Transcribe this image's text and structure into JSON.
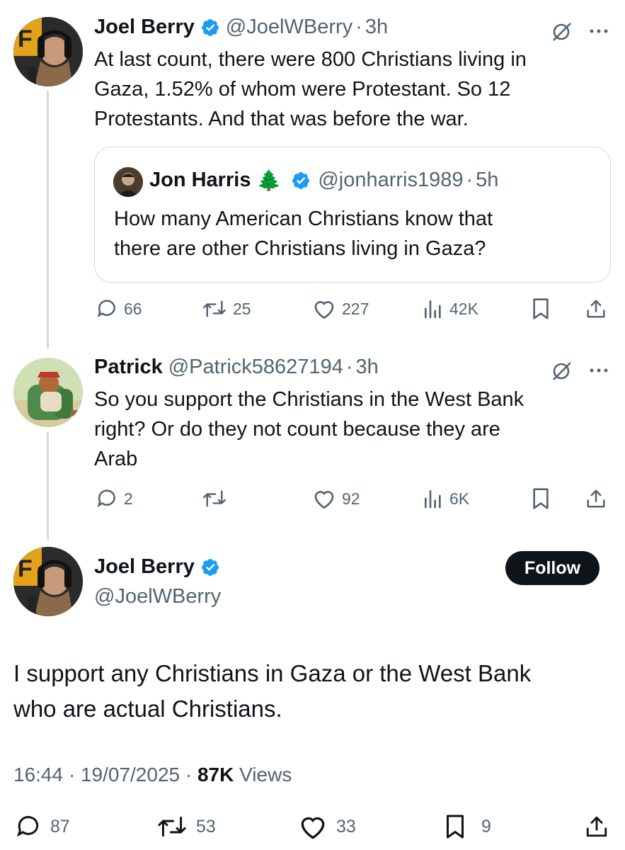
{
  "tweet1": {
    "name": "Joel Berry",
    "handle": "@JoelWBerry",
    "separator": "·",
    "time": "3h",
    "text_lines": [
      "At last count, there were 800 Christians living in",
      "Gaza, 1.52% of whom were Protestant. So 12",
      "Protestants. And that was before the war."
    ],
    "quote": {
      "name": "Jon Harris",
      "emoji": "🌲",
      "handle": "@jonharris1989",
      "separator": "·",
      "time": "5h",
      "text_lines": [
        "How many American Christians know that",
        "there are other Christians living in Gaza?"
      ]
    },
    "stats": {
      "replies": "66",
      "reposts": "25",
      "likes": "227",
      "views": "42K"
    }
  },
  "tweet2": {
    "name": "Patrick",
    "handle": "@Patrick58627194",
    "separator": "·",
    "time": "3h",
    "text_lines": [
      "So you support the Christians in the West Bank",
      "right? Or do they not count because they are",
      "Arab"
    ],
    "stats": {
      "replies": "2",
      "reposts": "",
      "likes": "92",
      "views": "6K"
    }
  },
  "main": {
    "name": "Joel Berry",
    "handle": "@JoelWBerry",
    "follow_label": "Follow",
    "text_lines": [
      "I support any Christians in Gaza or the West Bank",
      "who are actual Christians."
    ],
    "timestamp": "16:44 · 19/07/2025 · ",
    "views_count": "87K",
    "views_label": " Views",
    "stats": {
      "replies": "87",
      "reposts": "53",
      "likes": "33",
      "bookmarks": "9"
    }
  },
  "colors": {
    "verified": "#1d9bf0",
    "muted": "#536471",
    "text": "#0f1419",
    "border": "#cfd9de"
  },
  "icons": [
    "verified-badge-icon",
    "grok-icon",
    "more-icon",
    "reply-icon",
    "repost-icon",
    "like-icon",
    "views-icon",
    "bookmark-icon",
    "share-icon"
  ]
}
